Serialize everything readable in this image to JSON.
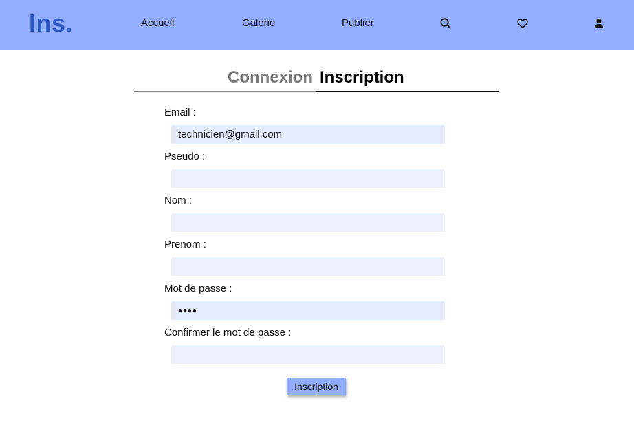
{
  "header": {
    "logo": "Ins.",
    "nav": {
      "home": "Accueil",
      "gallery": "Galerie",
      "publish": "Publier"
    },
    "icons": [
      "search-icon",
      "heart-icon",
      "user-icon"
    ]
  },
  "tabs": {
    "login": "Connexion",
    "register": "Inscription",
    "active": "register"
  },
  "form": {
    "email": {
      "label": "Email :",
      "value": "technicien@gmail.com"
    },
    "pseudo": {
      "label": "Pseudo :",
      "value": ""
    },
    "nom": {
      "label": "Nom :",
      "value": ""
    },
    "prenom": {
      "label": "Prenom :",
      "value": ""
    },
    "password": {
      "label": "Mot de passe :",
      "value": "abcd"
    },
    "confirm": {
      "label": "Confirmer le mot de passe :",
      "value": ""
    },
    "submit": "Inscription"
  },
  "colors": {
    "navbar": "#91adfb",
    "logo": "#2b58c4",
    "input_background": "#edf2fd",
    "active_tab": "#000000",
    "inactive_tab": "#7a7a7a"
  }
}
